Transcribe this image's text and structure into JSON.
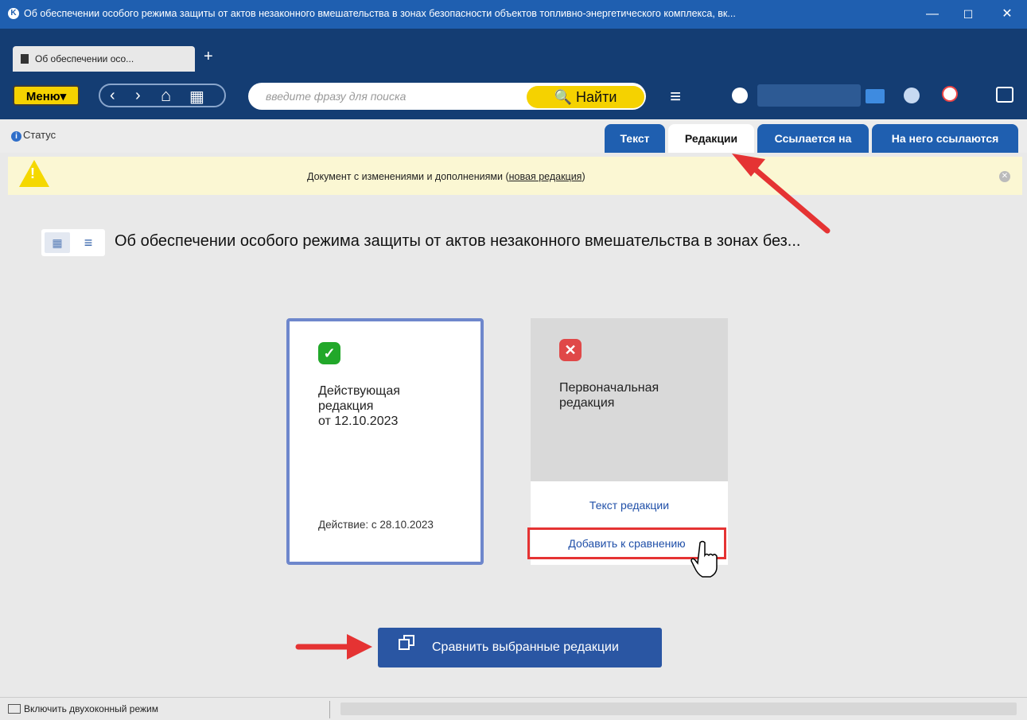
{
  "window": {
    "title": "Об обеспечении особого режима защиты от актов незаконного вмешательства в зонах безопасности объектов топливно-энергетического комплекса, вк...",
    "minimize": "—",
    "maximize": "☐",
    "close": "✕"
  },
  "tabs_bar": {
    "doc_tab_label": "Об обеспечении осо...",
    "add_tab": "+"
  },
  "toolbar": {
    "menu_label": "Меню▾",
    "back": "‹",
    "forward": "›",
    "home": "⌂",
    "apps": "▦",
    "search_placeholder": "введите фразу для поиска",
    "find_label": "🔍 Найти",
    "hamburger": "≡"
  },
  "status": {
    "label": "Статус"
  },
  "doc_tabs": [
    {
      "label": "Текст"
    },
    {
      "label": "Редакции"
    },
    {
      "label": "Ссылается на"
    },
    {
      "label": "На него ссылаются"
    }
  ],
  "warning": {
    "text_before": "Документ с изменениями и дополнениями (",
    "link": "новая редакция",
    "text_after": ")"
  },
  "main": {
    "doc_title": "Об обеспечении особого режима защиты от актов незаконного вмешательства в зонах без..."
  },
  "cards": [
    {
      "status": "active",
      "badge": "✓",
      "title": "Действующая\nредакция\nот 12.10.2023",
      "action": "Действие: с 28.10.2023"
    },
    {
      "status": "inactive",
      "badge": "✕",
      "title": "Первоначальная\nредакция",
      "text_link": "Текст редакции",
      "add_link": "Добавить к сравнению"
    }
  ],
  "compare_button": {
    "label": "Сравнить выбранные редакции"
  },
  "bottom": {
    "dual_mode": "Включить двухоконный режим"
  },
  "colors": {
    "titlebar": "#1f5fb0",
    "toolbar": "#143d73",
    "accent_yellow": "#f5d200",
    "tab_blue": "#1f5fb0",
    "warning_bg": "#fbf7d3",
    "card_border": "#6e87cc",
    "green_badge": "#22a82a",
    "red_badge": "#e04848",
    "link": "#1f4fa8",
    "compare_button": "#2a56a3",
    "annotation_red": "#e53333"
  }
}
